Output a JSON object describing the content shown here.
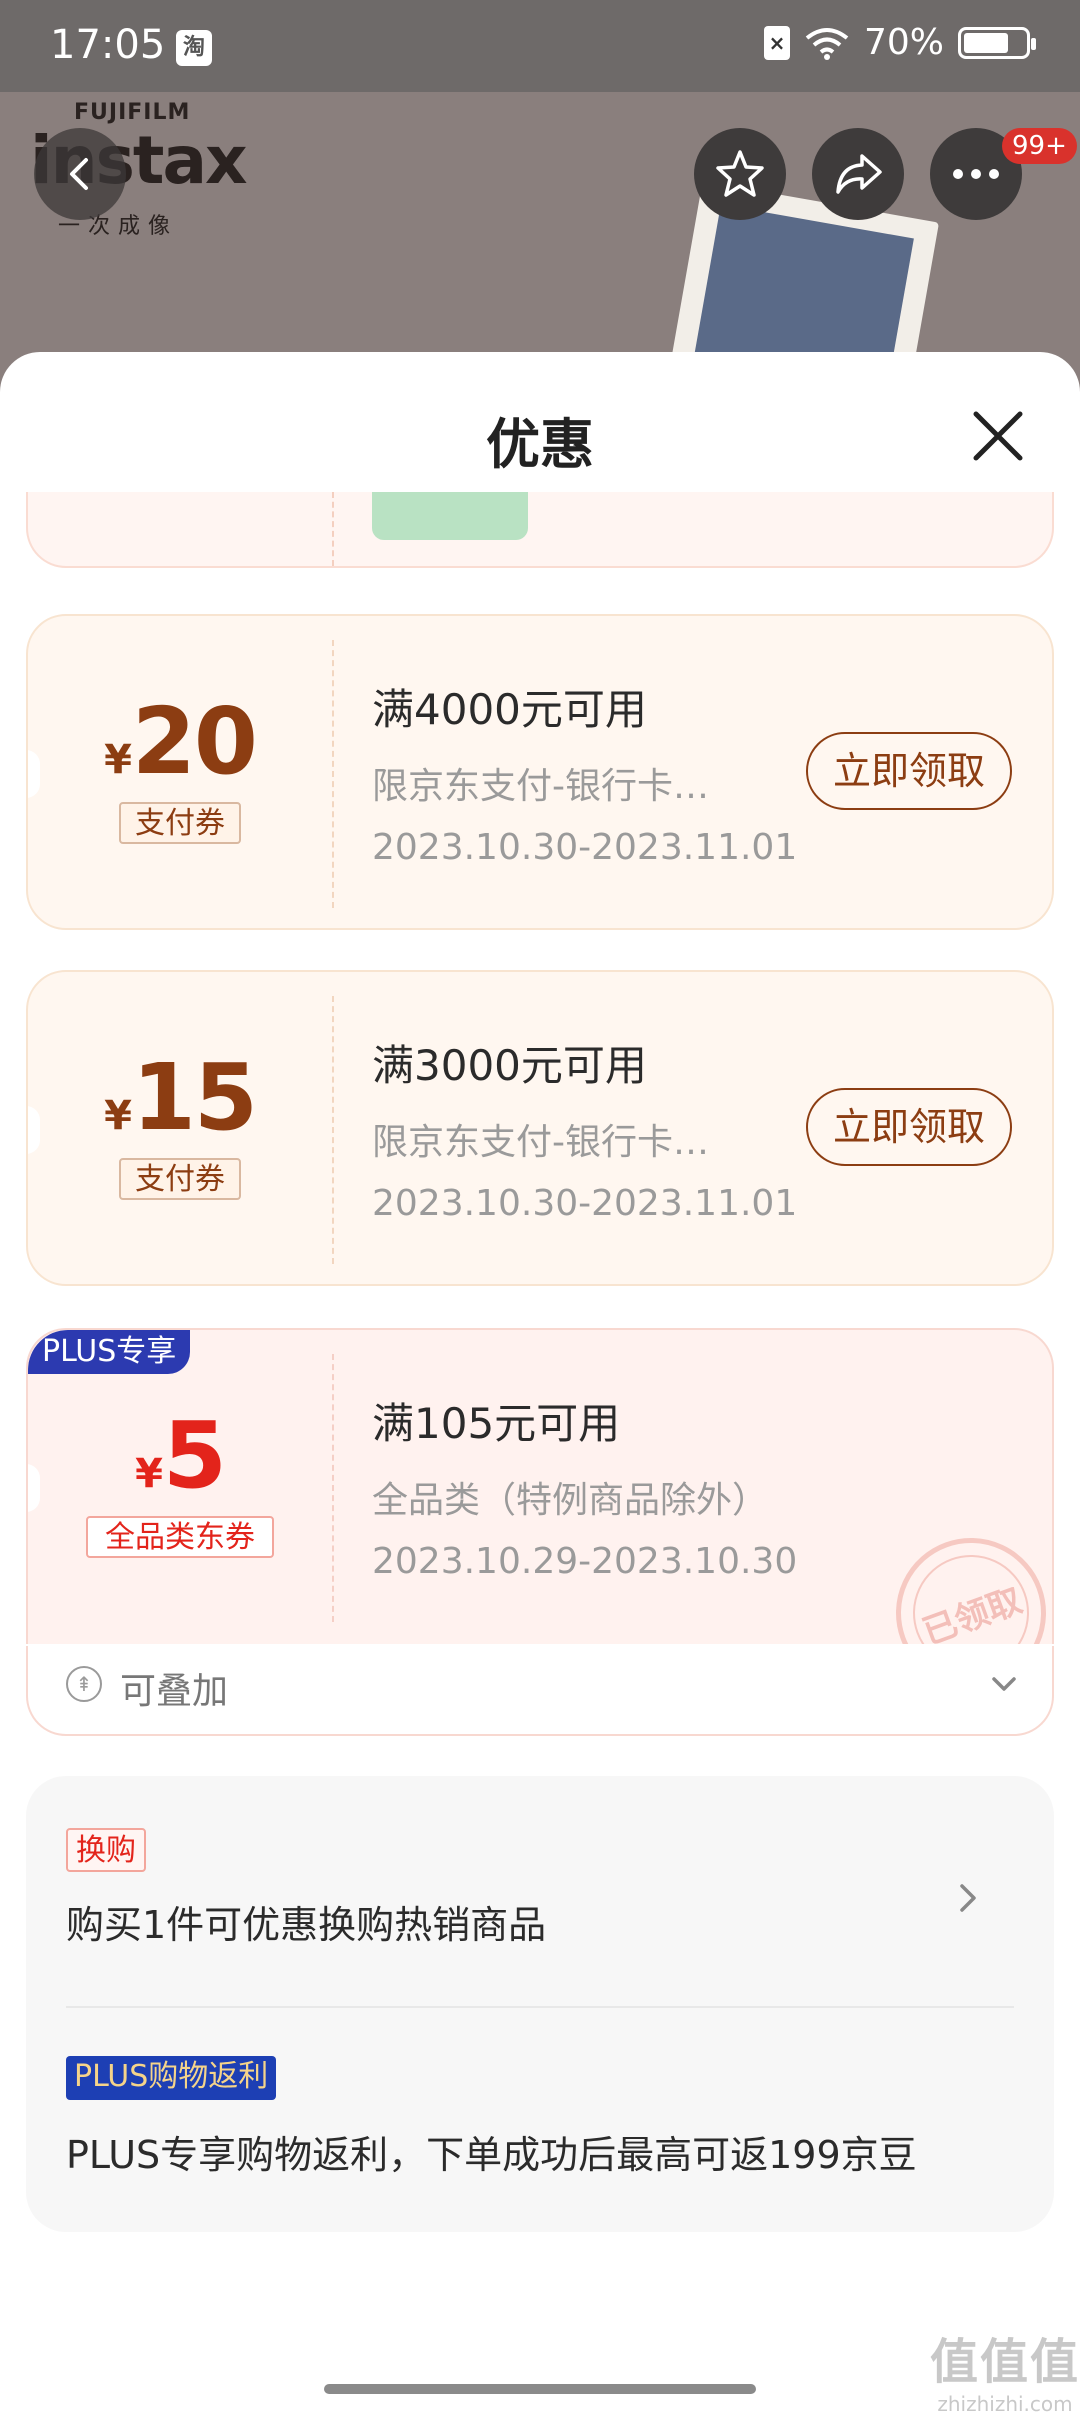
{
  "status_bar": {
    "time": "17:05",
    "app_icon_label": "淘",
    "sim_label": "×",
    "battery": "70%",
    "battery_level": 0.7
  },
  "product_header": {
    "brand_top": "FUJIFILM",
    "brand_main": "instax",
    "brand_sub": "一次成像",
    "cart_badge": "99+",
    "icons": [
      "back-icon",
      "star-icon",
      "share-icon",
      "more-icon"
    ]
  },
  "sheet": {
    "title": "优惠",
    "close_icon": "close-icon"
  },
  "coupons": [
    {
      "type": "pay",
      "currency": "¥",
      "amount": "20",
      "tag": "支付券",
      "title": "满4000元可用",
      "desc": "限京东支付-银行卡…",
      "date": "2023.10.30-2023.11.01",
      "button": "立即领取"
    },
    {
      "type": "pay",
      "currency": "¥",
      "amount": "15",
      "tag": "支付券",
      "title": "满3000元可用",
      "desc": "限京东支付-银行卡…",
      "date": "2023.10.30-2023.11.01",
      "button": "立即领取"
    },
    {
      "type": "plus",
      "badge": "PLUS专享",
      "currency": "¥",
      "amount": "5",
      "tag": "全品类东券",
      "title": "满105元可用",
      "desc": "全品类（特例商品除外）",
      "date": "2023.10.29-2023.10.30",
      "stamp": "已领取"
    }
  ],
  "stackable": {
    "label": "可叠加"
  },
  "promos": [
    {
      "tag": "换购",
      "text": "购买1件可优惠换购热销商品"
    },
    {
      "tag": "PLUS购物返利",
      "text": "PLUS专享购物返利，下单成功后最高可返199京豆"
    }
  ],
  "watermark": {
    "main": "值值值",
    "sub": "zhizhizhi.com"
  },
  "colors": {
    "pay_accent": "#8c3d12",
    "plus_accent": "#e3241b",
    "plus_badge": "#2c3ab0"
  }
}
